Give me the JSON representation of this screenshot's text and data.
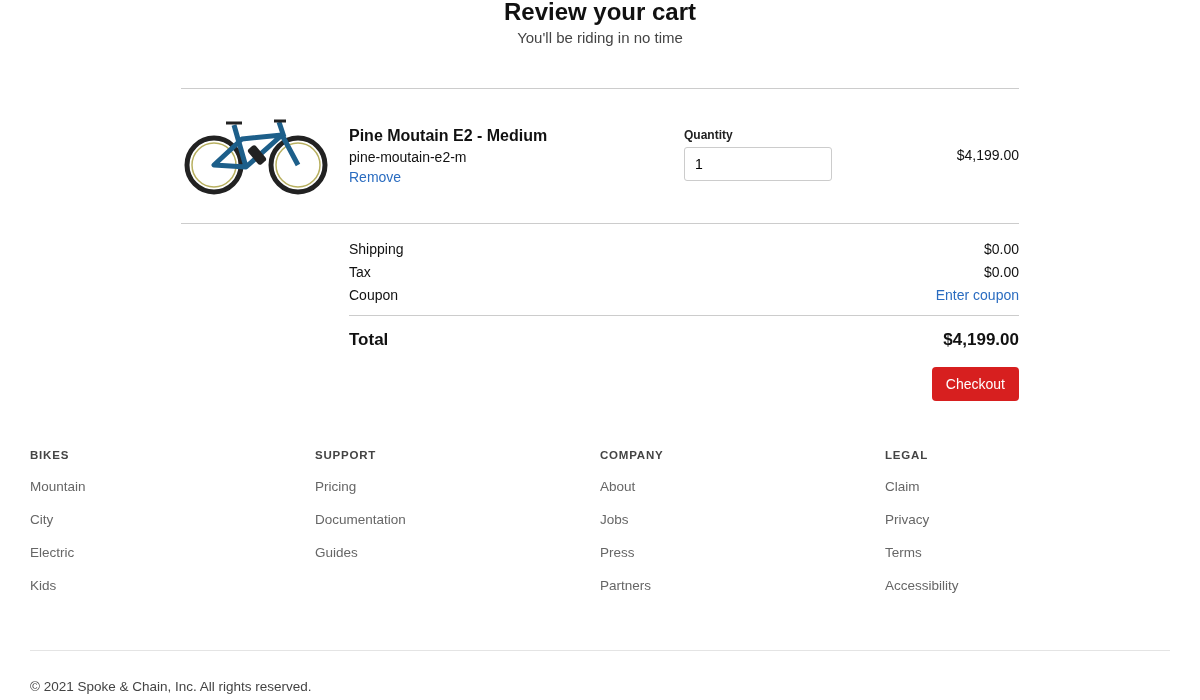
{
  "header": {
    "title": "Review your cart",
    "subtitle": "You'll be riding in no time"
  },
  "cart_items": [
    {
      "name": "Pine Moutain E2 - Medium",
      "sku": "pine-moutain-e2-m",
      "remove_label": "Remove",
      "quantity_label": "Quantity",
      "quantity": "1",
      "price": "$4,199.00"
    }
  ],
  "summary": {
    "rows": [
      {
        "kind": "amount",
        "label": "Shipping",
        "value": "$0.00"
      },
      {
        "kind": "amount",
        "label": "Tax",
        "value": "$0.00"
      },
      {
        "kind": "link",
        "label": "Coupon",
        "value": "Enter coupon"
      }
    ],
    "total_label": "Total",
    "total_value": "$4,199.00",
    "checkout": "Checkout"
  },
  "footer": {
    "columns": [
      {
        "heading": "BIKES",
        "links": [
          "Mountain",
          "City",
          "Electric",
          "Kids"
        ]
      },
      {
        "heading": "SUPPORT",
        "links": [
          "Pricing",
          "Documentation",
          "Guides"
        ]
      },
      {
        "heading": "COMPANY",
        "links": [
          "About",
          "Jobs",
          "Press",
          "Partners"
        ]
      },
      {
        "heading": "LEGAL",
        "links": [
          "Claim",
          "Privacy",
          "Terms",
          "Accessibility"
        ]
      }
    ],
    "copyright": "© 2021 Spoke & Chain, Inc. All rights reserved."
  }
}
